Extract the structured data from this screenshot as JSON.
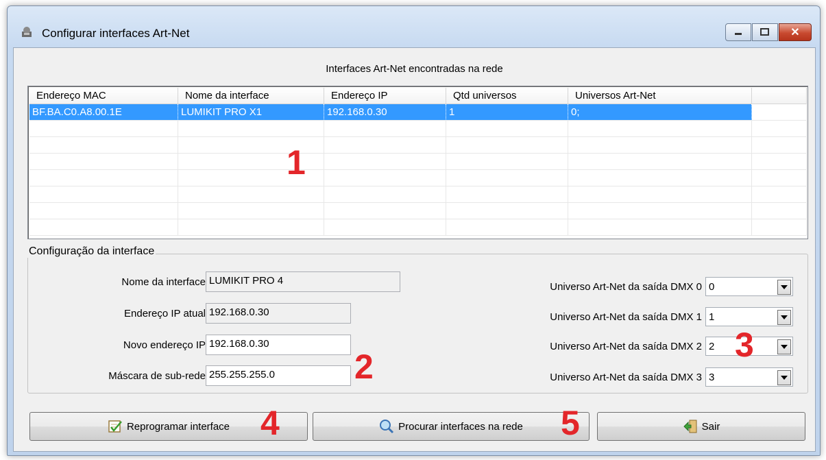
{
  "window": {
    "title": "Configurar interfaces Art-Net",
    "close_glyph": "✕"
  },
  "list": {
    "caption": "Interfaces Art-Net encontradas na rede",
    "columns": [
      "Endereço MAC",
      "Nome da interface",
      "Endereço IP",
      "Qtd universos",
      "Universos Art-Net"
    ],
    "rows": [
      {
        "mac": "BF.BA.C0.A8.00.1E",
        "name": "LUMIKIT PRO X1",
        "ip": "192.168.0.30",
        "count": "1",
        "universes": "0;"
      }
    ]
  },
  "config": {
    "legend": "Configuração da interface",
    "name_label": "Nome da interface",
    "name_value": "LUMIKIT PRO 4",
    "ip_label": "Endereço IP atual",
    "ip_value": "192.168.0.30",
    "new_ip_label": "Novo endereço IP",
    "new_ip_value": "192.168.0.30",
    "mask_label": "Máscara de sub-rede",
    "mask_value": "255.255.255.0",
    "dmx": [
      {
        "label": "Universo Art-Net da saída DMX 0",
        "value": "0"
      },
      {
        "label": "Universo Art-Net da saída DMX 1",
        "value": "1"
      },
      {
        "label": "Universo Art-Net da saída DMX 2",
        "value": "2"
      },
      {
        "label": "Universo Art-Net da saída DMX 3",
        "value": "3"
      }
    ]
  },
  "buttons": {
    "reprogram": "Reprogramar interface",
    "search": "Procurar interfaces na rede",
    "exit": "Sair"
  },
  "annotations": [
    "1",
    "2",
    "3",
    "4",
    "5"
  ],
  "colors": {
    "selection": "#3399ff",
    "annotation": "#e3262a"
  }
}
